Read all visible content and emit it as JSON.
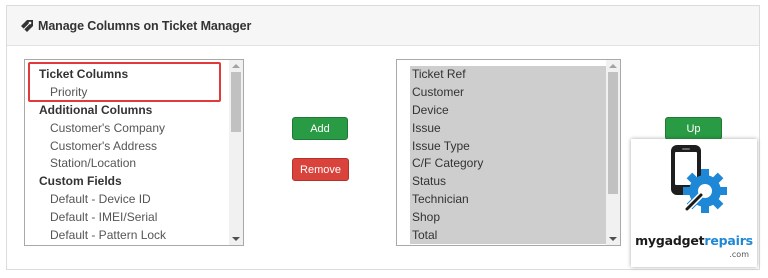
{
  "panel": {
    "title": "Manage Columns on Ticket Manager",
    "title_icon": "tag-icon"
  },
  "left_list": {
    "items": [
      {
        "label": "Ticket Columns",
        "type": "group"
      },
      {
        "label": "Priority",
        "type": "child"
      },
      {
        "label": "Additional Columns",
        "type": "group"
      },
      {
        "label": "Customer's Company",
        "type": "child"
      },
      {
        "label": "Customer's Address",
        "type": "child"
      },
      {
        "label": "Station/Location",
        "type": "child"
      },
      {
        "label": "Custom Fields",
        "type": "group"
      },
      {
        "label": "Default - Device ID",
        "type": "child"
      },
      {
        "label": "Default - IMEI/Serial",
        "type": "child"
      },
      {
        "label": "Default - Pattern Lock",
        "type": "child"
      }
    ]
  },
  "right_list": {
    "items": [
      "Ticket Ref",
      "Customer",
      "Device",
      "Issue",
      "Issue Type",
      "C/F Category",
      "Status",
      "Technician",
      "Shop",
      "Total"
    ]
  },
  "buttons": {
    "add": "Add",
    "remove": "Remove",
    "up": "Up"
  },
  "logo": {
    "text_dark": "mygadget",
    "text_blue": "repairs",
    "suffix": ".com"
  },
  "colors": {
    "add_button": "#2a9b45",
    "remove_button": "#d9433b",
    "highlight": "#e03a3a",
    "selected_bg": "#cecece",
    "logo_blue": "#1e88d6"
  }
}
